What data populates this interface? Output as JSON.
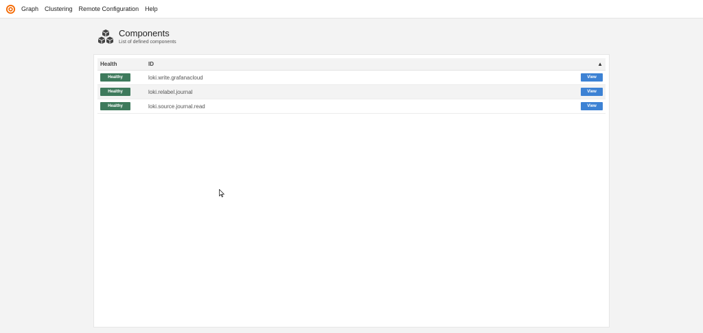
{
  "nav": {
    "items": [
      {
        "label": "Graph"
      },
      {
        "label": "Clustering"
      },
      {
        "label": "Remote Configuration"
      },
      {
        "label": "Help"
      }
    ]
  },
  "header": {
    "title": "Components",
    "subtitle": "List of defined components",
    "icon": "cubes-icon"
  },
  "table": {
    "columns": {
      "health": "Health",
      "id": "ID"
    },
    "sort_indicator": "▲",
    "rows": [
      {
        "health": "Healthy",
        "id": "loki.write.grafanacloud",
        "action": "View"
      },
      {
        "health": "Healthy",
        "id": "loki.relabel.journal",
        "action": "View"
      },
      {
        "health": "Healthy",
        "id": "loki.source.journal.read",
        "action": "View"
      }
    ]
  },
  "colors": {
    "healthy_badge": "#3e7a5c",
    "view_button": "#3d82d4",
    "logo": "#f46800"
  }
}
